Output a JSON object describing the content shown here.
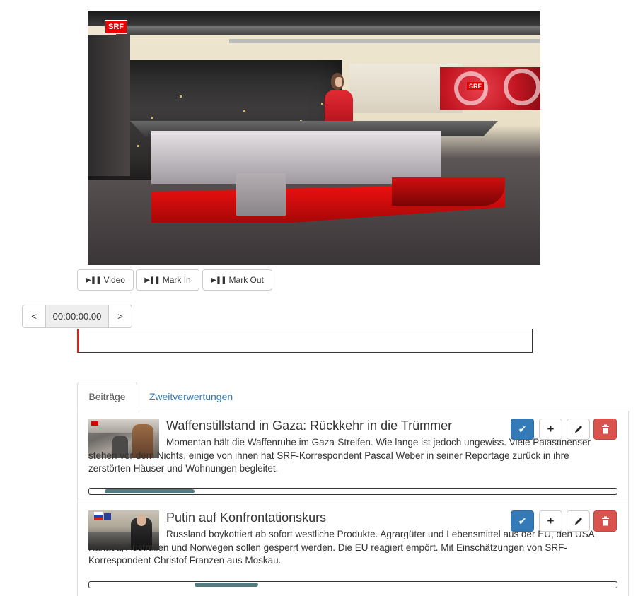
{
  "video": {
    "channel_logo": "SRF",
    "screen_logo": "SRF",
    "alt": "video-frame"
  },
  "controls": {
    "play_video_label": "Video",
    "mark_in_label": "Mark In",
    "mark_out_label": "Mark Out",
    "play_pause_icon": "play-pause-icon"
  },
  "timecode": {
    "prev_label": "<",
    "value": "00:00:00.00",
    "next_label": ">"
  },
  "tabs": [
    {
      "label": "Beiträge",
      "active": true
    },
    {
      "label": "Zweitverwertungen",
      "active": false
    }
  ],
  "items": [
    {
      "title": "Waffenstillstand in Gaza: Rückkehr in die Trümmer",
      "description": "Momentan hält die Waffenruhe im Gaza-Streifen. Wie lange ist jedoch ungewiss. Viele Palästinenser stehen vor dem Nichts, einige von ihnen hat SRF-Korrespondent Pascal Weber in seiner Reportage zurück in ihre zerstörten Häuser und Wohnungen begleitet.",
      "range_start": 0.03,
      "range_end": 0.2
    },
    {
      "title": "Putin auf Konfrontationskurs",
      "description": "Russland boykottiert ab sofort westliche Produkte. Agrargüter und Lebensmittel aus der EU, den USA, Kanada, Australien und Norwegen sollen gesperrt werden. Die EU reagiert empört. Mit Einschätzungen von SRF-Korrespondent Christof Franzen aus Moskau.",
      "range_start": 0.2,
      "range_end": 0.32
    }
  ],
  "item_actions": {
    "confirm_icon": "checkmark-icon",
    "add_icon": "plus-icon",
    "edit_icon": "pencil-icon",
    "delete_icon": "trash-icon"
  },
  "colors": {
    "primary": "#337ab7",
    "danger": "#d9534f",
    "timeline_marker": "#d9211d",
    "progress_fill": "#537a7e"
  }
}
